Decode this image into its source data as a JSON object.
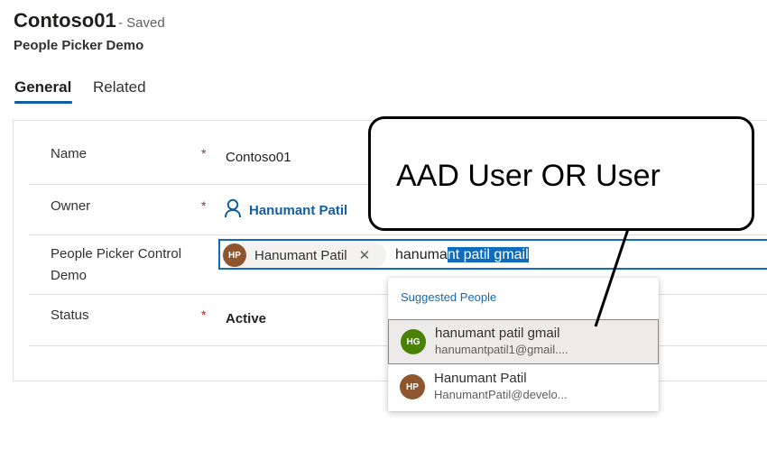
{
  "header": {
    "record_title": "Contoso01",
    "save_status": "- Saved",
    "form_name": "People Picker Demo"
  },
  "tabs": [
    {
      "label": "General",
      "active": true
    },
    {
      "label": "Related",
      "active": false
    }
  ],
  "form": {
    "name": {
      "label": "Name",
      "required": "*",
      "value": "Contoso01"
    },
    "owner": {
      "label": "Owner",
      "required": "*",
      "value": "Hanumant Patil",
      "icon": "person-icon"
    },
    "people_picker": {
      "label_line1": "People Picker Control",
      "label_line2": "Demo",
      "selected_chip": {
        "initials": "HP",
        "name": "Hanumant Patil",
        "remove": "✕"
      },
      "typed_plain": "hanuma",
      "typed_selected": "nt patil gmail"
    },
    "status": {
      "label": "Status",
      "required": "*",
      "value": "Active"
    }
  },
  "suggestions": {
    "header": "Suggested People",
    "people": [
      {
        "initials": "HG",
        "name": "hanumant patil gmail",
        "email": "hanumantpatil1@gmail....",
        "color": "#498205",
        "highlighted": true
      },
      {
        "initials": "HP",
        "name": "Hanumant Patil",
        "email": "HanumantPatil@develo...",
        "color": "#8e562e",
        "highlighted": false
      }
    ]
  },
  "callout": {
    "text": "AAD User OR User"
  },
  "colors": {
    "accent": "#0f6cbd",
    "required": "#a4262c",
    "hp_avatar": "#8e562e",
    "hg_avatar": "#498205"
  }
}
